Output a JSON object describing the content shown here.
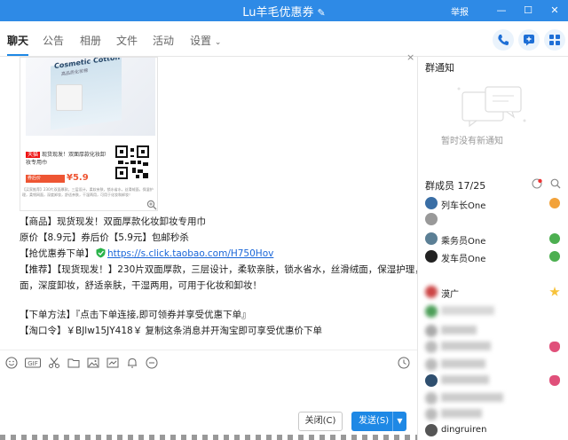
{
  "window": {
    "title": "Lu羊毛优惠券",
    "report": "举报",
    "controls": [
      "minimize",
      "maximize",
      "close"
    ]
  },
  "tabs": [
    {
      "label": "聊天",
      "active": true
    },
    {
      "label": "公告"
    },
    {
      "label": "相册"
    },
    {
      "label": "文件"
    },
    {
      "label": "活动"
    },
    {
      "label": "设置"
    }
  ],
  "product_card": {
    "box_label": "Cosmetic Cotton",
    "box_sub": "高品质化妆棉",
    "tagline": "现货现发！双面厚款化妆卸妆专用巾",
    "tmall": "天猫",
    "price": "¥5.9",
    "price_bar_label": "券后价",
    "small_print": "【买家推荐】230片双面厚款，三层设计，柔软亲肤，锁水省水，丝滑绒面，保湿护理，柔韧网面，深度卸妆，舒适亲肤，干湿两用，可用于化妆和卸妆！"
  },
  "messages": {
    "line1": "【商品】现货现发！双面厚款化妆卸妆专用巾",
    "line2": "原价【8.9元】券后价【5.9元】包邮秒杀",
    "line3_prefix": "【抢优惠券下单】",
    "link": "https://s.click.taobao.com/H750Hov",
    "line4": "【推荐】【现货现发！】230片双面厚款，三层设计，柔软亲肤，锁水省水，丝滑绒面，保湿护理，柔韧网",
    "line5": "面，深度卸妆，舒适亲肤，干湿两用，可用于化妆和卸妆！",
    "line6": "【下单方法】『点击下单连接,即可领券并享受优惠下单』",
    "line7": "【淘口令】￥BJlw15JY418￥  复制这条消息并开淘宝即可享受优惠价下单"
  },
  "toolbar_icons": [
    "emoji-icon",
    "gif-icon",
    "scissors-icon",
    "folder-icon",
    "image-icon",
    "screenshot-icon",
    "bell-icon",
    "more-icon",
    "history-icon"
  ],
  "buttons": {
    "close": "关闭(C)",
    "send": "发送(S)"
  },
  "right_panel": {
    "notice_title": "群通知",
    "notice_empty": "暂时没有新通知",
    "members_title": "群成员 17/25",
    "members": [
      {
        "name": "列车长One"
      },
      {
        "name": "乘务员One"
      },
      {
        "name": "发车员One"
      },
      {
        "name": "漠广"
      },
      {
        "name": "dingruiren"
      }
    ]
  },
  "colors": {
    "accent": "#1e88e5",
    "titlebar": "#2e8ae6",
    "link": "#1a66d8",
    "price": "#e53333"
  }
}
